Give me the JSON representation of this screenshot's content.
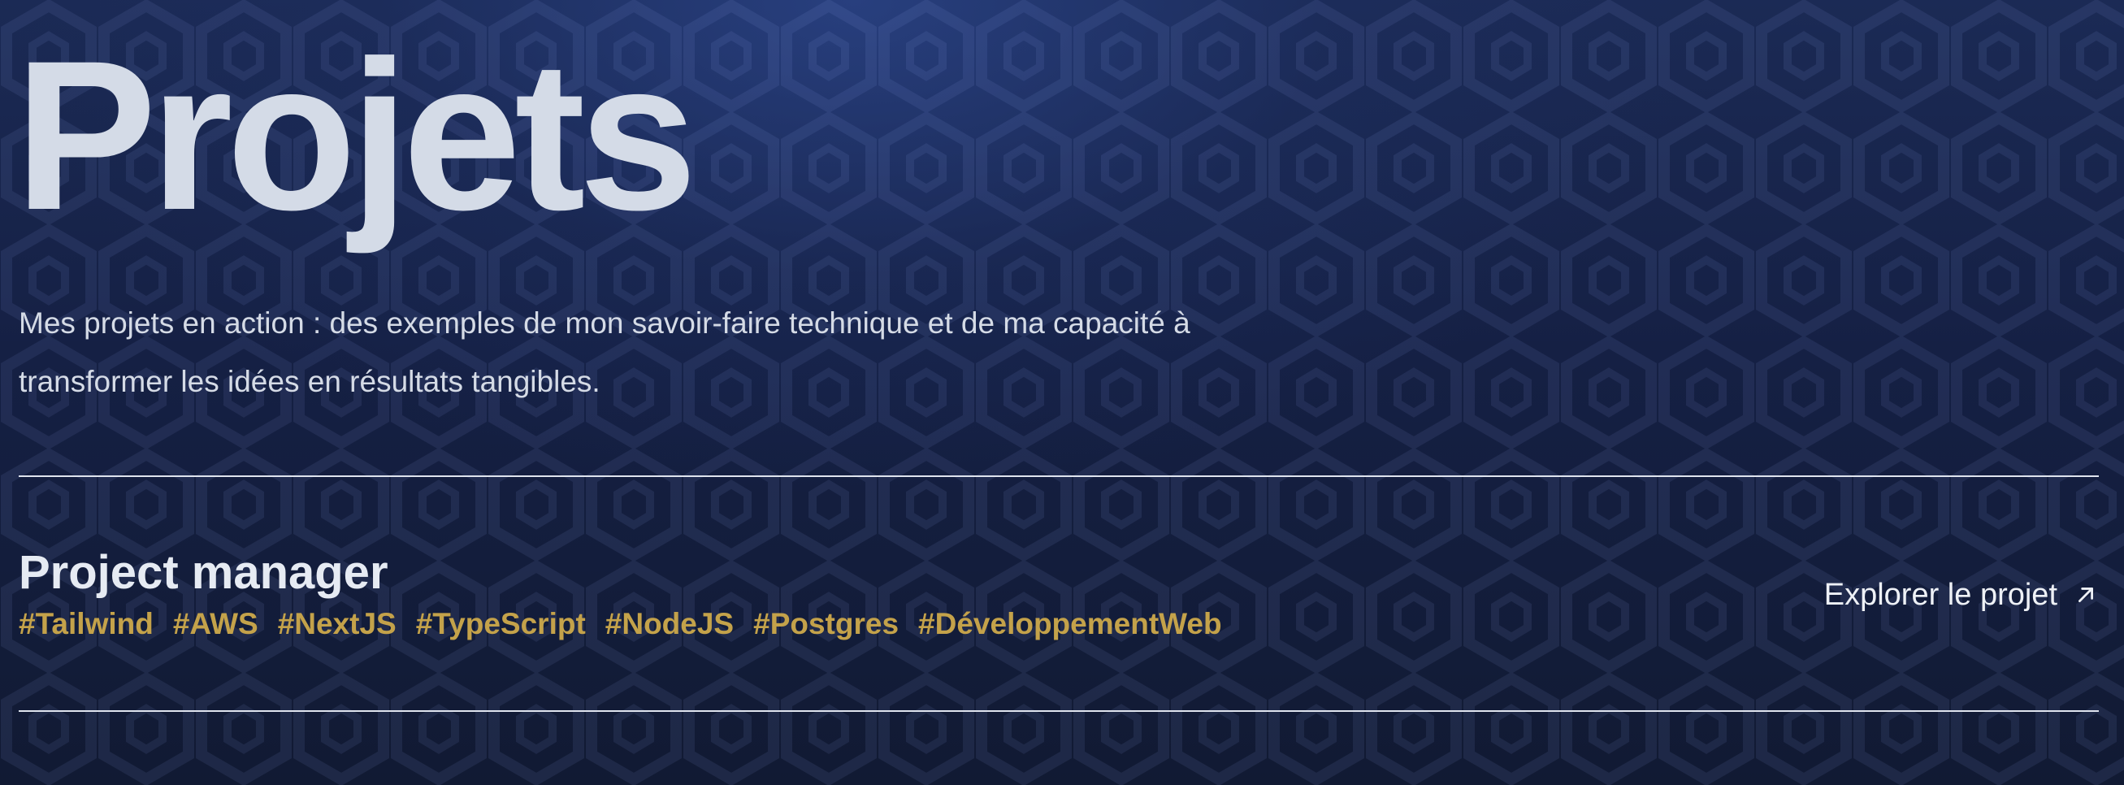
{
  "page": {
    "title": "Projets",
    "intro_line_1": "Mes projets en action : des exemples de mon savoir-faire technique et de ma capacité à",
    "intro_line_2": "transformer les idées en résultats tangibles."
  },
  "project": {
    "name": "Project manager",
    "tags": [
      "#Tailwind",
      "#AWS",
      "#NextJS",
      "#TypeScript",
      "#NodeJS",
      "#Postgres",
      "#DéveloppementWeb"
    ],
    "link_label": "Explorer le projet",
    "link_icon": "arrow-up-right-icon"
  },
  "colors": {
    "background": "#141d36",
    "title": "#d4dbe7",
    "tag": "#c4a24a",
    "text": "#d5dbe6"
  }
}
